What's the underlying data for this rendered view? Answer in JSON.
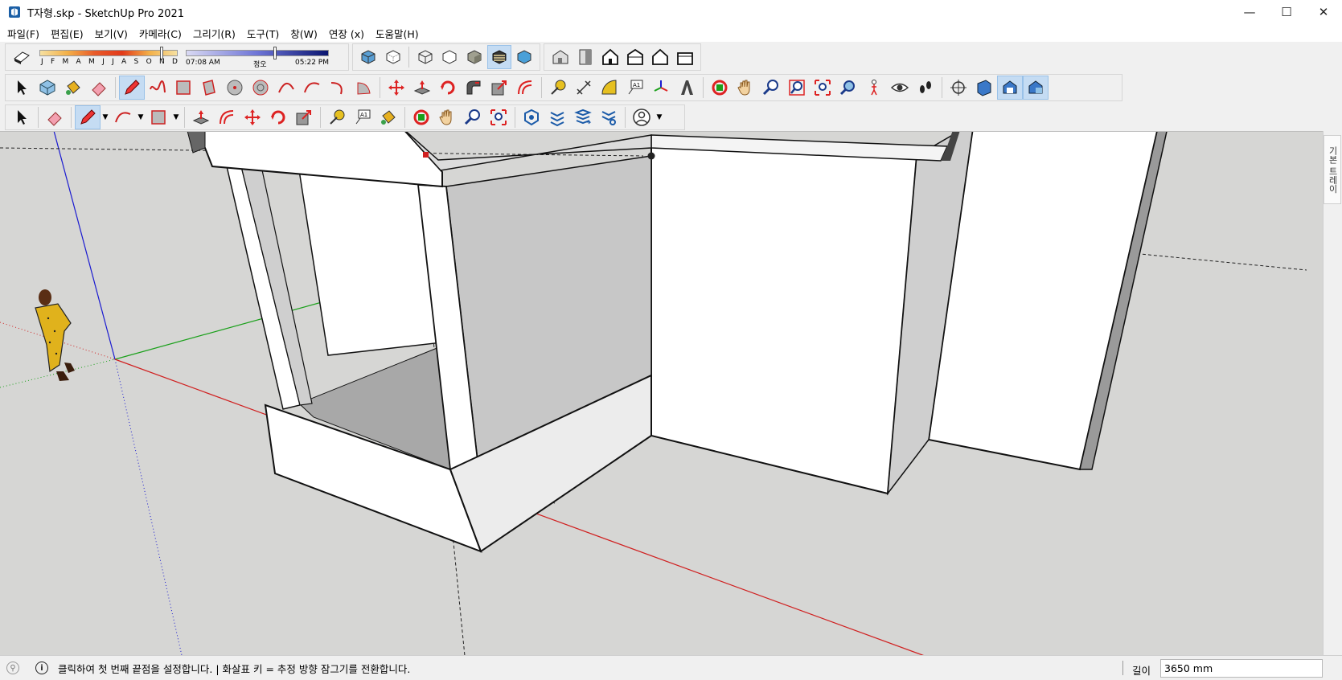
{
  "window": {
    "title": "T자형.skp - SketchUp Pro 2021",
    "minimize_symbol": "—",
    "maximize_symbol": "☐",
    "close_symbol": "✕"
  },
  "menu": [
    "파일(F)",
    "편집(E)",
    "보기(V)",
    "카메라(C)",
    "그리기(R)",
    "도구(T)",
    "창(W)",
    "연장 (x)",
    "도움말(H)"
  ],
  "shadows": {
    "months": [
      "J",
      "F",
      "M",
      "A",
      "M",
      "J",
      "J",
      "A",
      "S",
      "O",
      "N",
      "D"
    ],
    "time_start": "07:08 AM",
    "time_mid": "정오",
    "time_end": "05:22 PM"
  },
  "toolbar_icons": {
    "styles": [
      "xray-icon",
      "back-edges-icon",
      "wireframe-icon",
      "hidden-line-icon",
      "shaded-icon",
      "shaded-textures-icon",
      "monochrome-icon"
    ],
    "views": [
      "iso-view-icon",
      "top-view-icon",
      "front-view-icon",
      "right-view-icon",
      "back-view-icon",
      "left-view-icon"
    ]
  },
  "tray": {
    "tab_label": "기본 트레이"
  },
  "status": {
    "hint": "클릭하여 첫 번째 끝점을 설정합니다. | 화살표 키 = 추정 방향 잠그기를 전환합니다.",
    "measure_label": "길이",
    "measure_value": "3650 mm"
  },
  "colors": {
    "viewport_bg": "#d6d6d4",
    "red_axis": "#d02020",
    "green_axis": "#1aa01a",
    "blue_axis": "#1a1ad0",
    "face_light": "#ffffff",
    "face_shade": "#c9c9c9",
    "face_dark": "#a8a8a8"
  }
}
